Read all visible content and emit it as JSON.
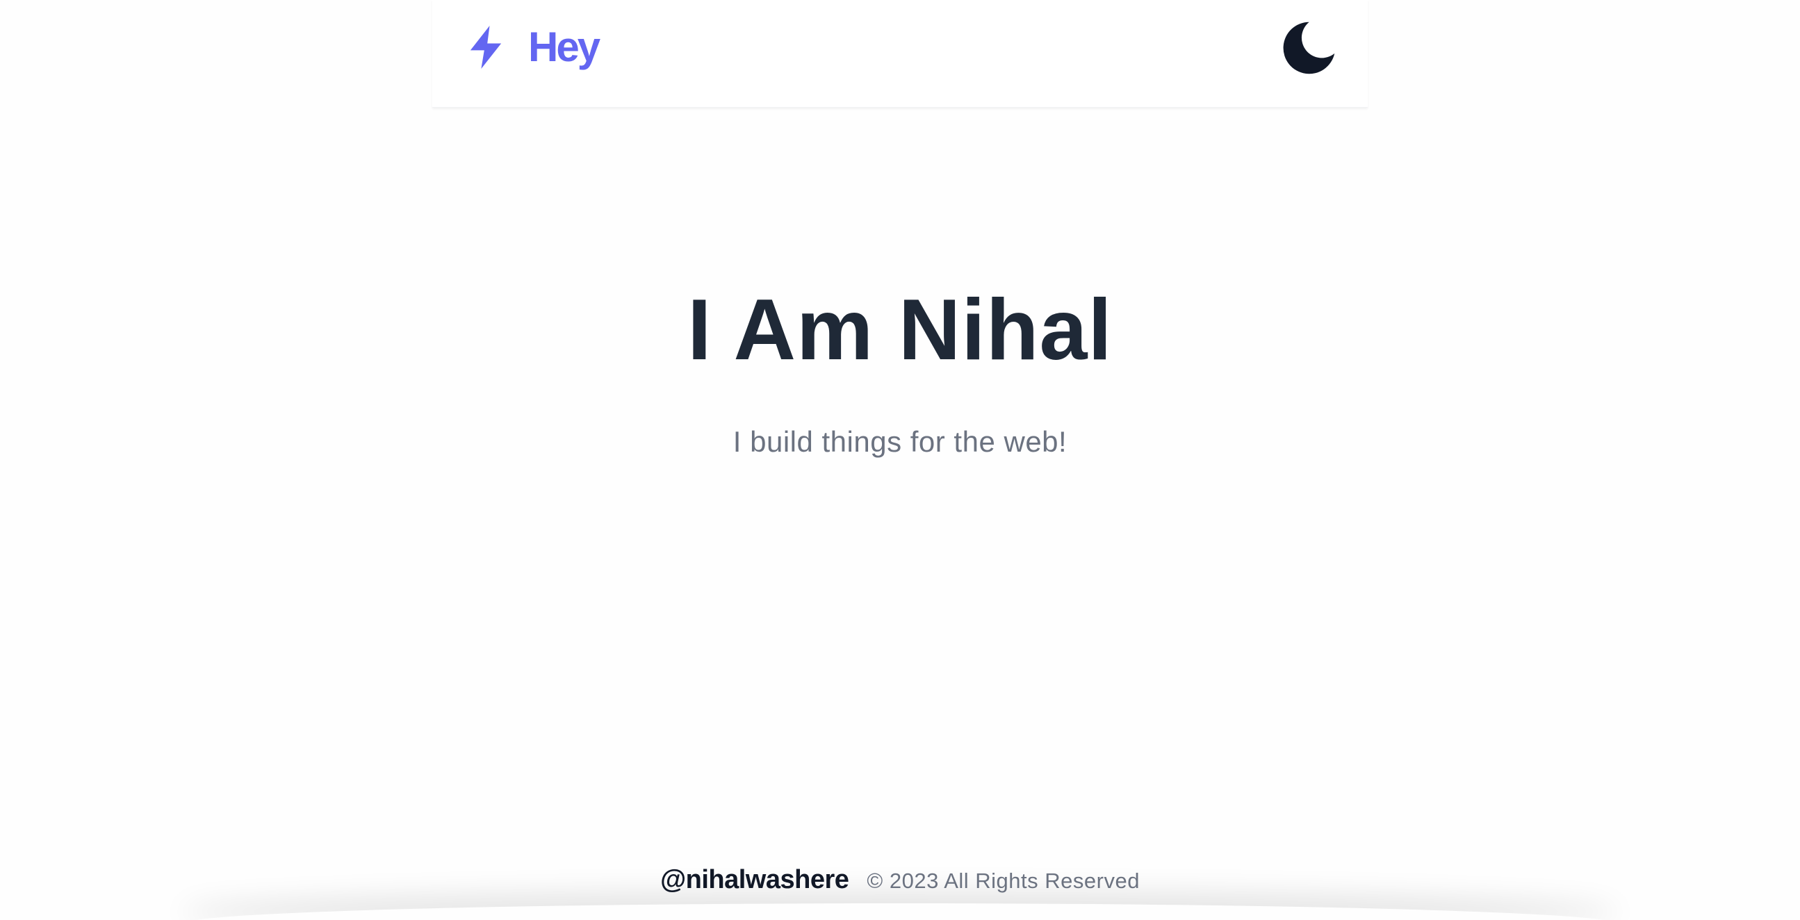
{
  "header": {
    "brand_label": "Hey",
    "brand_icon": "lightning-bolt-icon",
    "theme_toggle_icon": "moon-icon"
  },
  "hero": {
    "title": "I Am Nihal",
    "subtitle": "I build things for the web!"
  },
  "footer": {
    "handle": "@nihalwashere",
    "copyright": "© 2023 All Rights Reserved"
  },
  "colors": {
    "accent": "#6366f1",
    "heading": "#1f2937",
    "muted": "#6b7280",
    "dark": "#111827",
    "background": "#fefefe"
  }
}
